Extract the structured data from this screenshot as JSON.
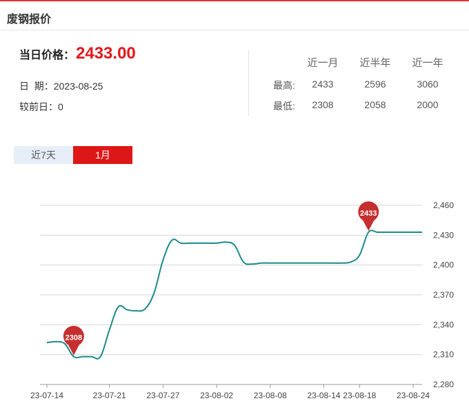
{
  "header": {
    "title": "废钢报价"
  },
  "price": {
    "label": "当日价格：",
    "value": "2433.00"
  },
  "info": {
    "date_label": "日  期：",
    "date_value": "2023-08-25",
    "change_label": "较前日：",
    "change_value": "0"
  },
  "stats": {
    "columns": [
      "近一月",
      "近半年",
      "近一年"
    ],
    "rows": [
      {
        "label": "最高:",
        "values": [
          "2433",
          "2596",
          "3060"
        ]
      },
      {
        "label": "最低:",
        "values": [
          "2308",
          "2058",
          "2000"
        ]
      }
    ]
  },
  "tabs": [
    {
      "label": "近7天",
      "active": false
    },
    {
      "label": "1月",
      "active": true
    }
  ],
  "colors": {
    "accent": "#dd1717",
    "price": "#e5161b",
    "line": "#1a8a8a",
    "pin": "#c62f2f"
  },
  "chart_data": {
    "type": "line",
    "x_tick_labels": [
      "23-07-14",
      "23-07-21",
      "23-07-27",
      "23-08-02",
      "23-08-08",
      "23-08-14",
      "23-08-18",
      "23-08-24"
    ],
    "y_ticks": [
      2280,
      2310,
      2340,
      2370,
      2400,
      2430,
      2460
    ],
    "y_tick_labels": [
      "2,280",
      "2,310",
      "2,340",
      "2,370",
      "2,400",
      "2,430",
      "2,460"
    ],
    "ylim": [
      2280,
      2460
    ],
    "series": [
      {
        "points": [
          [
            "07-14",
            2322
          ],
          [
            "07-15",
            2323
          ],
          [
            "07-16",
            2321
          ],
          [
            "07-17",
            2308
          ],
          [
            "07-18",
            2308
          ],
          [
            "07-19",
            2308
          ],
          [
            "07-20",
            2308
          ],
          [
            "07-21",
            2335
          ],
          [
            "07-22",
            2358
          ],
          [
            "07-23",
            2355
          ],
          [
            "07-24",
            2354
          ],
          [
            "07-25",
            2356
          ],
          [
            "07-26",
            2372
          ],
          [
            "07-27",
            2405
          ],
          [
            "07-28",
            2425
          ],
          [
            "07-29",
            2422
          ],
          [
            "07-30",
            2422
          ],
          [
            "07-31",
            2422
          ],
          [
            "08-01",
            2422
          ],
          [
            "08-02",
            2422
          ],
          [
            "08-03",
            2423
          ],
          [
            "08-04",
            2420
          ],
          [
            "08-05",
            2403
          ],
          [
            "08-06",
            2401
          ],
          [
            "08-07",
            2402
          ],
          [
            "08-08",
            2402
          ],
          [
            "08-09",
            2402
          ],
          [
            "08-10",
            2402
          ],
          [
            "08-11",
            2402
          ],
          [
            "08-12",
            2402
          ],
          [
            "08-13",
            2402
          ],
          [
            "08-14",
            2402
          ],
          [
            "08-15",
            2402
          ],
          [
            "08-16",
            2402
          ],
          [
            "08-17",
            2403
          ],
          [
            "08-18",
            2410
          ],
          [
            "08-19",
            2433
          ],
          [
            "08-20",
            2433
          ],
          [
            "08-21",
            2433
          ],
          [
            "08-22",
            2433
          ],
          [
            "08-23",
            2433
          ],
          [
            "08-24",
            2433
          ],
          [
            "08-25",
            2433
          ]
        ]
      }
    ],
    "annotations": [
      {
        "label": "2308",
        "x": "07-17",
        "y": 2308
      },
      {
        "label": "2433",
        "x": "08-19",
        "y": 2433
      }
    ],
    "grid": true
  }
}
